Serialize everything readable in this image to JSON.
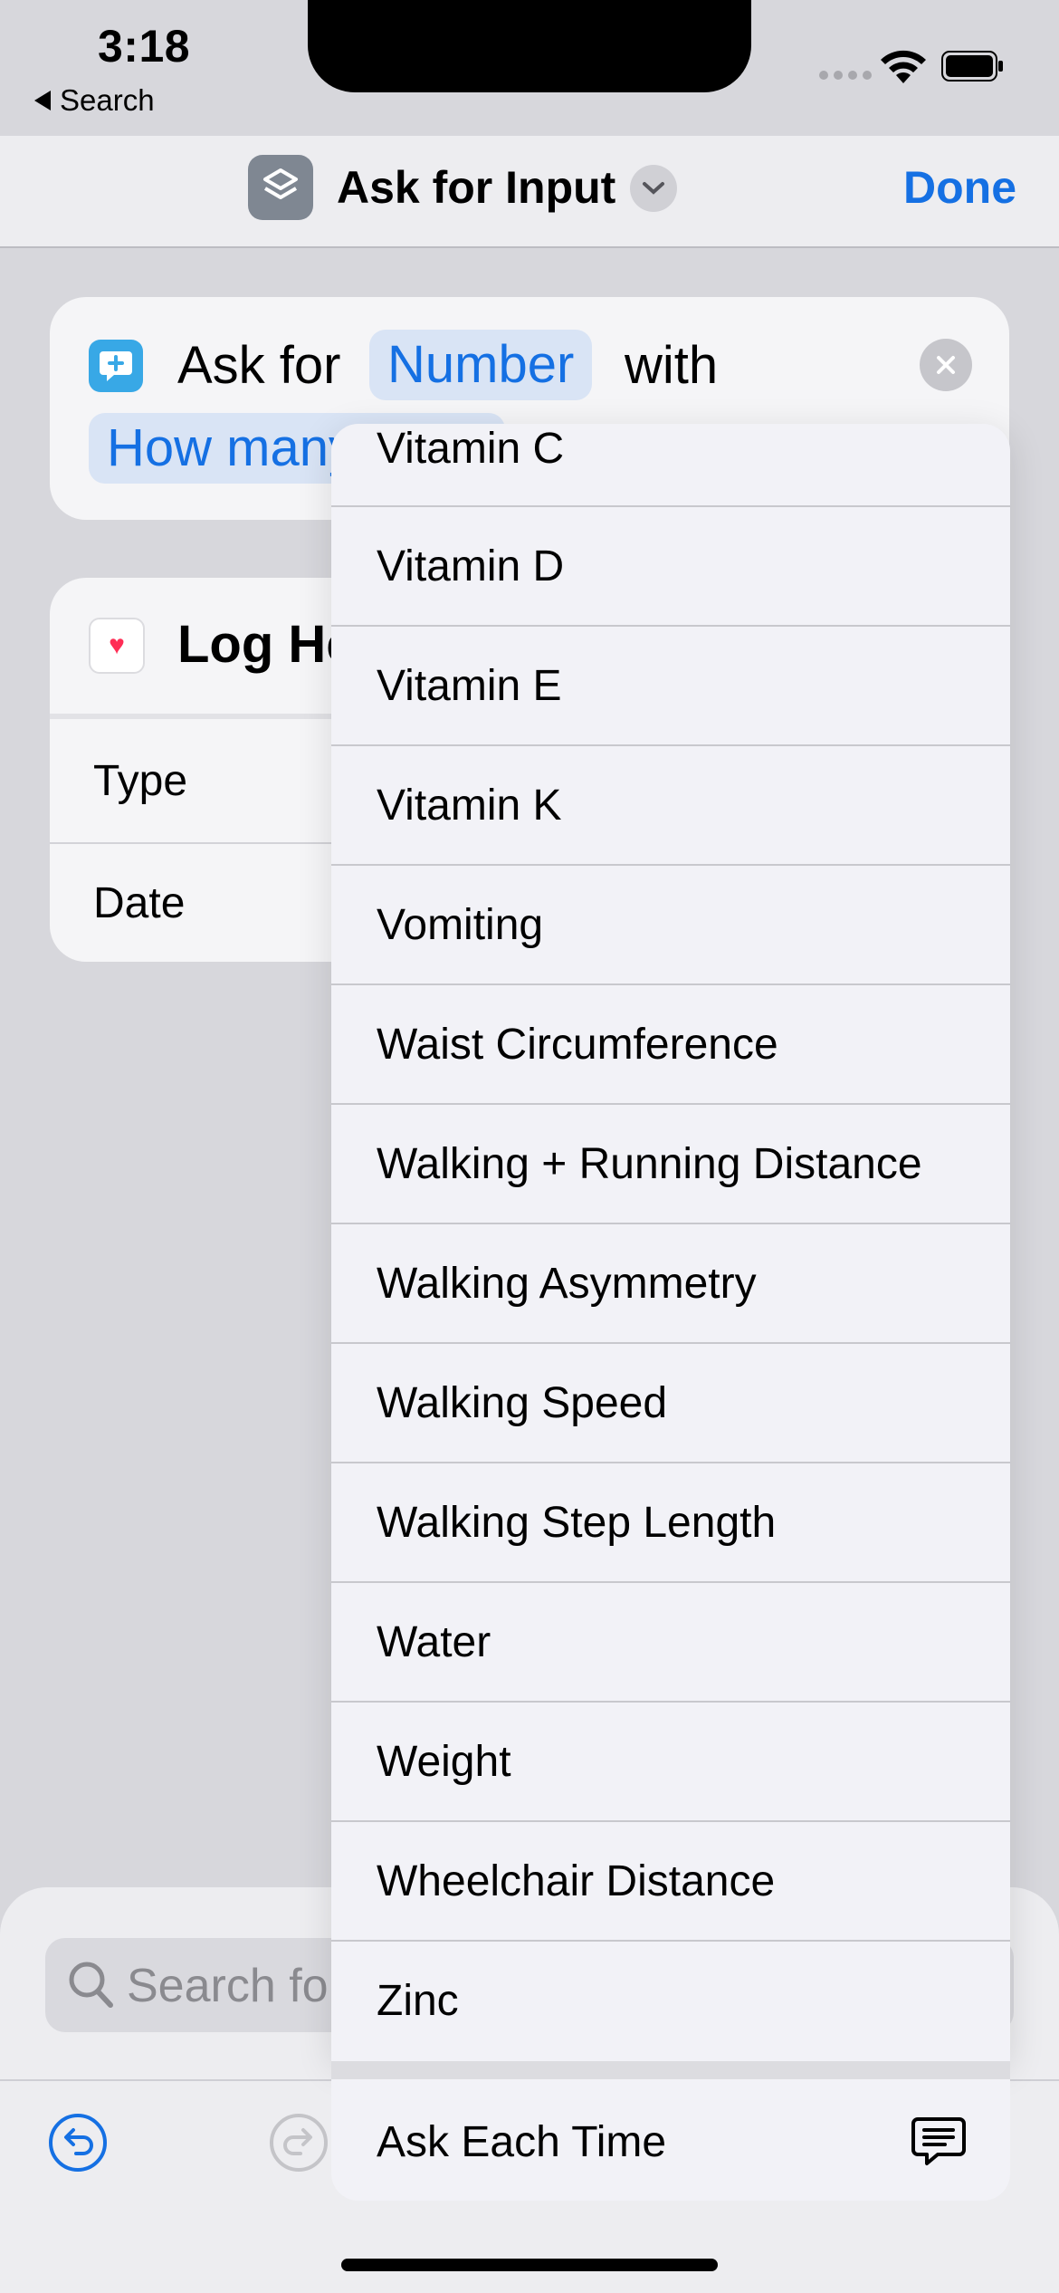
{
  "status_bar": {
    "time": "3:18",
    "back_label": "Search"
  },
  "nav": {
    "title": "Ask for Input",
    "done_label": "Done"
  },
  "ask_card": {
    "ask_for": "Ask for",
    "number_pill": "Number",
    "with": "with",
    "prompt_pill": "How many"
  },
  "log_card": {
    "title": "Log He",
    "type_label": "Type",
    "date_label": "Date"
  },
  "search": {
    "placeholder": "Search for"
  },
  "dropdown": {
    "items": [
      "Vitamin C",
      "Vitamin D",
      "Vitamin E",
      "Vitamin K",
      "Vomiting",
      "Waist Circumference",
      "Walking + Running Distance",
      "Walking Asymmetry",
      "Walking Speed",
      "Walking Step Length",
      "Water",
      "Weight",
      "Wheelchair Distance",
      "Zinc"
    ],
    "ask_each_time": "Ask Each Time"
  },
  "colors": {
    "accent": "#1570e3",
    "pill_bg": "#d9e4f5",
    "shortcut_icon": "#38a8e6"
  },
  "icons": [
    "back-triangle-icon",
    "wifi-icon",
    "battery-icon",
    "shortcuts-app-icon",
    "chevron-down-icon",
    "done",
    "message-plus-icon",
    "close-icon",
    "heart-icon",
    "search-icon",
    "undo-icon",
    "redo-icon",
    "message-bubble-icon"
  ]
}
